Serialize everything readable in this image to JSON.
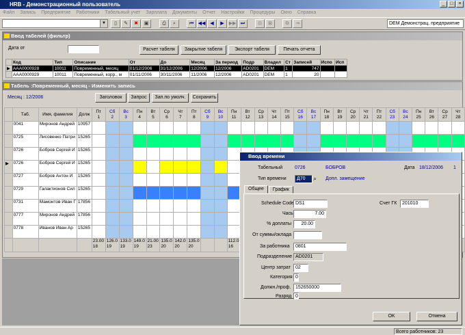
{
  "app": {
    "title": "HRB - Демонстрационный пользователь"
  },
  "menu": [
    "Файл",
    "Запись",
    "Предприятие",
    "Работники",
    "Табельный учет",
    "Зарплата",
    "Документы",
    "Отчет",
    "Настройки",
    "Процедуры",
    "Окно",
    "Справка"
  ],
  "toolbar": {
    "context": "DEM Демонстрац. предприятие"
  },
  "filter_window": {
    "title": "Ввод табелей (фильтр)",
    "date_from_label": "Дата от",
    "date_from_value": "",
    "buttons": {
      "calc": "Расчет табеля",
      "close": "Закрытие табеля",
      "export": "Экспорт табеля",
      "print": "Печать отчета"
    },
    "columns": [
      "Код",
      "Тип",
      "Описание",
      "От",
      "До",
      "Месяц",
      "За период",
      "Подр",
      "Владел",
      "Ст",
      "Записей",
      "Испо",
      "Исп"
    ],
    "rows": [
      [
        "AAA0000928",
        "10011",
        "Повременный, месяц",
        "01/12/2006",
        "31/12/2006",
        "12/2006",
        "12/2006",
        "AD0201",
        "DEM",
        "1",
        "747",
        "",
        ""
      ],
      [
        "AAA0000929",
        "10011",
        "Повременный, корр., м",
        "01/11/2006",
        "30/11/2006",
        "11/2006",
        "12/2006",
        "AD0201",
        "DEM",
        "1",
        "20",
        "",
        ""
      ]
    ]
  },
  "timesheet": {
    "title": "Табель :Повременный, месяц - Изменить запись",
    "month": "Месяц : 12/2006",
    "buttons": {
      "header": "Заголовок",
      "request": "Запрос",
      "fill_default": "Зап.по умолч.",
      "save": "Сохранить"
    },
    "col_tab": "Таб.",
    "col_name": "Имя, фамилия",
    "col_pos": "Долж",
    "days": [
      {
        "wd": "Пт",
        "d": "1"
      },
      {
        "wd": "Сб",
        "d": "2"
      },
      {
        "wd": "Вс",
        "d": "3"
      },
      {
        "wd": "Пн",
        "d": "4"
      },
      {
        "wd": "Вт",
        "d": "5"
      },
      {
        "wd": "Ср",
        "d": "6"
      },
      {
        "wd": "Чт",
        "d": "7"
      },
      {
        "wd": "Пт",
        "d": "8"
      },
      {
        "wd": "Сб",
        "d": "9"
      },
      {
        "wd": "Вс",
        "d": "10"
      },
      {
        "wd": "Пн",
        "d": "11"
      },
      {
        "wd": "Вт",
        "d": "12"
      },
      {
        "wd": "Ср",
        "d": "13"
      },
      {
        "wd": "Чт",
        "d": "14"
      },
      {
        "wd": "Пт",
        "d": "15"
      },
      {
        "wd": "Сб",
        "d": "16"
      },
      {
        "wd": "Вс",
        "d": "17"
      },
      {
        "wd": "Пн",
        "d": "18"
      },
      {
        "wd": "Вт",
        "d": "19"
      },
      {
        "wd": "Ср",
        "d": "20"
      },
      {
        "wd": "Чт",
        "d": "21"
      },
      {
        "wd": "Пт",
        "d": "22"
      },
      {
        "wd": "Сб",
        "d": "23"
      },
      {
        "wd": "Вс",
        "d": "24"
      },
      {
        "wd": "Пн",
        "d": "25"
      },
      {
        "wd": "Вт",
        "d": "26"
      },
      {
        "wd": "Ср",
        "d": "27"
      },
      {
        "wd": "Чт",
        "d": "28"
      }
    ],
    "rows": [
      {
        "tab": "0041",
        "name": "Миронов Андрей",
        "pos": "10957"
      },
      {
        "tab": "0725",
        "name": "Лисовенко Патри",
        "pos": "15265"
      },
      {
        "tab": "0726",
        "name": "Бобров Сергей И",
        "pos": "15265"
      },
      {
        "tab": "0726",
        "name": "Бобров Сергей И",
        "pos": "15265"
      },
      {
        "tab": "0727",
        "name": "Бобров Антон И",
        "pos": "15265"
      },
      {
        "tab": "0729",
        "name": "Галактионов Сил",
        "pos": "15265"
      },
      {
        "tab": "0731",
        "name": "Мамонтов Иван Г",
        "pos": "17856"
      },
      {
        "tab": "0777",
        "name": "Миронов Андрей",
        "pos": "17856"
      },
      {
        "tab": "0778",
        "name": "Иванов Иван Ар",
        "pos": "15265"
      }
    ],
    "totals": [
      "23.00\n18",
      "126.0\n19",
      "133.0\n19",
      "149.0\n19",
      "21.00\n23",
      "135.0\n20",
      "142.0\n20",
      "135.0\n20",
      "",
      "",
      "112.0\n16",
      "133.0\n19"
    ]
  },
  "time_dialog": {
    "title": "Ввод времени",
    "tab_num_label": "Табельный",
    "tab_num": "0726",
    "surname": "БОБРОВ",
    "date_label": "Дата",
    "date": "18/12/2006",
    "date_n": "1",
    "time_type_label": "Тип времени",
    "time_type": "Д70",
    "time_type_desc": "Допл. замещение",
    "tabs": [
      "Общее",
      "График"
    ],
    "schedule_code_label": "Schedule Code",
    "schedule_code": "DS1",
    "gk_label": "Счет ГК",
    "gk": "201010",
    "hours_label": "Часы",
    "hours": "7.00",
    "pct_label": "% доплаты",
    "pct": "20.00",
    "from_sum_label": "От суммы/оклада",
    "from_sum": "",
    "for_worker_label": "За работника",
    "for_worker": "0801",
    "dept_label": "Подразделение",
    "dept": "AD0201",
    "cost_center_label": "Центр затрат",
    "cost_center": "02",
    "category_label": "Категория",
    "category": "0",
    "position_label": "Должн./проф.",
    "position": "152650000",
    "rank_label": "Разряд",
    "rank": "0",
    "ok": "OK",
    "cancel": "Отмена"
  },
  "status": {
    "total_workers": "Всего работников: 23"
  }
}
